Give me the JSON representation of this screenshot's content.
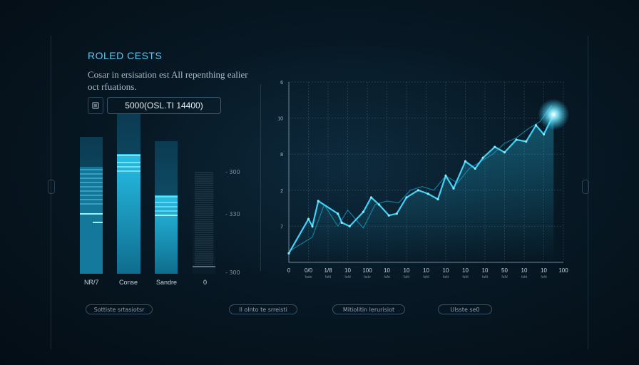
{
  "header": {
    "title": "ROLED CESTS",
    "subtitle": "Cosar in ersisation est All repenthing ealier oct rfuations.",
    "readout": "5000(OSL.TI 14400)"
  },
  "bars": {
    "labels": [
      "NR/7",
      "Conse",
      "Sandre",
      "0"
    ]
  },
  "gauge": {
    "labels": [
      "- 300",
      "- 330",
      "- 300"
    ]
  },
  "chart_data": {
    "type": "line",
    "ylabel_ticks": [
      "6",
      "10",
      "8",
      "2",
      "7"
    ],
    "x_ticks": [
      "0",
      "0/0",
      "1/8",
      "10",
      "100",
      "10",
      "10",
      "10",
      "10",
      "10",
      "10",
      "50",
      "10",
      "10",
      "100"
    ],
    "x_subticks": [
      "",
      "fade",
      "fafd",
      "fafd",
      "fade",
      "fafd",
      "fafd",
      "fafd",
      "fafd",
      "fafd",
      "fafd",
      "fafd",
      "fafd",
      "fafd",
      ""
    ],
    "xlim": [
      0,
      14
    ],
    "ylim": [
      0,
      5
    ],
    "grid": true,
    "series": [
      {
        "values_x": [
          0,
          1.0,
          1.2,
          1.5,
          2.5,
          2.7,
          3.1,
          3.8,
          4.2,
          4.6,
          5.1,
          5.5,
          6.0,
          6.6,
          7.1,
          7.6,
          8.0,
          8.4,
          9.0,
          9.5,
          9.9,
          10.5,
          11.0,
          11.6,
          12.1,
          12.6,
          13.0,
          13.5
        ],
        "values_y": [
          0.25,
          1.2,
          1.0,
          1.7,
          1.35,
          1.1,
          1.0,
          1.4,
          1.8,
          1.6,
          1.3,
          1.35,
          1.8,
          2.0,
          1.9,
          1.75,
          2.4,
          2.05,
          2.8,
          2.6,
          2.9,
          3.2,
          3.05,
          3.4,
          3.35,
          3.8,
          3.55,
          4.1
        ]
      },
      {
        "values_x": [
          0,
          1.2,
          1.8,
          2.5,
          3.0,
          3.8,
          4.4,
          5.0,
          5.6,
          6.2,
          6.8,
          7.4,
          8.0,
          8.6,
          9.2,
          9.8,
          10.4,
          11.0,
          11.6,
          12.2,
          12.8,
          13.4
        ],
        "values_y": [
          0.3,
          0.7,
          1.6,
          1.0,
          1.45,
          0.95,
          1.6,
          1.7,
          1.65,
          2.0,
          2.1,
          2.0,
          2.4,
          2.2,
          2.6,
          2.8,
          3.0,
          3.3,
          3.45,
          3.7,
          3.9,
          4.35
        ]
      }
    ]
  },
  "legend_pills": [
    "Sottiste srtasiotsr",
    "Il olnto te srreisti",
    "Mitiolitin lerurisiot",
    "Ulsste se0"
  ],
  "colors": {
    "accent": "#29c6f0",
    "bar_dark": "#0c4f68",
    "glow": "#9ff0ff"
  }
}
